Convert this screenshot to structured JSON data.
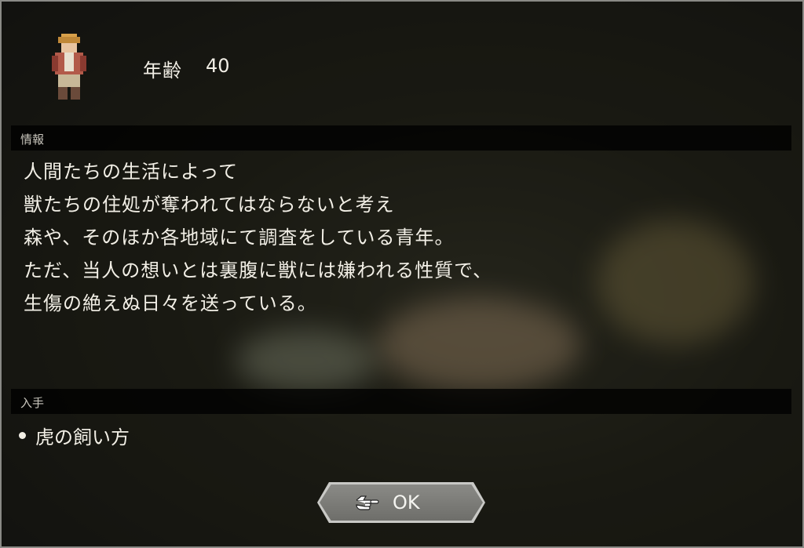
{
  "profile": {
    "age_label": "年齢",
    "age_value": "40",
    "portrait_icon": "traveler-sprite-icon"
  },
  "info": {
    "heading": "情報",
    "lines": [
      "人間たちの生活によって",
      "獣たちの住処が奪われてはならないと考え",
      "森や、そのほか各地域にて調査をしている青年。",
      "ただ、当人の想いとは裏腹に獣には嫌われる性質で、",
      "生傷の絶えぬ日々を送っている。"
    ]
  },
  "acquire": {
    "heading": "入手",
    "items": [
      "虎の飼い方"
    ]
  },
  "button": {
    "ok_label": "OK",
    "icon": "pointing-hand-icon"
  },
  "colors": {
    "panel_bar": "#000000",
    "button_face": "#7c7c78",
    "text": "#f2efe6"
  }
}
